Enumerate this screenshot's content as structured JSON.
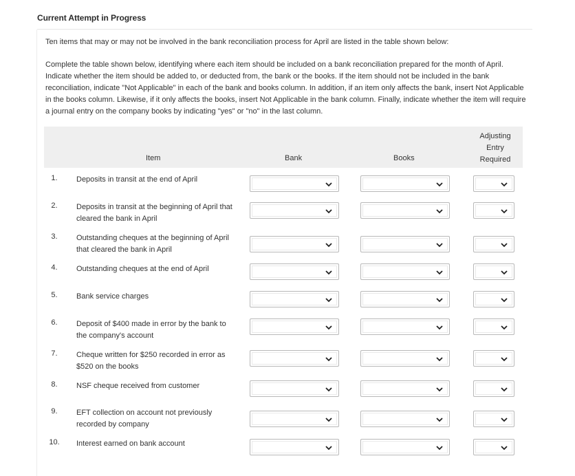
{
  "header": {
    "title": "Current Attempt in Progress"
  },
  "intro": "Ten items that may or may not be involved in the bank reconciliation process for April are listed in the table shown below:",
  "instructions": "Complete the table shown below, identifying where each item should be included on a bank reconciliation prepared for the month of April. Indicate whether the item should be added to, or deducted from, the bank or the books. If the item should not be included in the bank reconciliation, indicate \"Not Applicable\" in each of the bank and books column. In addition, if an item only affects the bank, insert Not Applicable in the books column. Likewise, if it only affects the books, insert Not Applicable in the bank column. Finally, indicate whether the item will require a journal entry on the company books by indicating \"yes\" or \"no\" in the last column.",
  "table": {
    "columns": {
      "item": "Item",
      "bank": "Bank",
      "books": "Books",
      "adjusting": [
        "Adjusting",
        "Entry",
        "Required"
      ]
    },
    "rows": [
      {
        "num": "1.",
        "item": "Deposits in transit at the end of April",
        "bank": "",
        "books": "",
        "adjusting": ""
      },
      {
        "num": "2.",
        "item": "Deposits in transit at the beginning of April that cleared the bank in April",
        "bank": "",
        "books": "",
        "adjusting": ""
      },
      {
        "num": "3.",
        "item": "Outstanding cheques at the beginning of April that cleared the bank in April",
        "bank": "",
        "books": "",
        "adjusting": ""
      },
      {
        "num": "4.",
        "item": "Outstanding cheques at the end of April",
        "bank": "",
        "books": "",
        "adjusting": ""
      },
      {
        "num": "5.",
        "item": "Bank service charges",
        "bank": "",
        "books": "",
        "adjusting": ""
      },
      {
        "num": "6.",
        "item": "Deposit of $400 made in error by the bank to the company's account",
        "bank": "",
        "books": "",
        "adjusting": ""
      },
      {
        "num": "7.",
        "item": "Cheque written for $250 recorded in error as $520 on the books",
        "bank": "",
        "books": "",
        "adjusting": ""
      },
      {
        "num": "8.",
        "item": "NSF cheque received from customer",
        "bank": "",
        "books": "",
        "adjusting": ""
      },
      {
        "num": "9.",
        "item": "EFT collection on account not previously recorded by company",
        "bank": "",
        "books": "",
        "adjusting": ""
      },
      {
        "num": "10.",
        "item": "Interest earned on bank account",
        "bank": "",
        "books": "",
        "adjusting": ""
      }
    ]
  },
  "icons": {
    "dropdown": "chevron-down-icon"
  }
}
